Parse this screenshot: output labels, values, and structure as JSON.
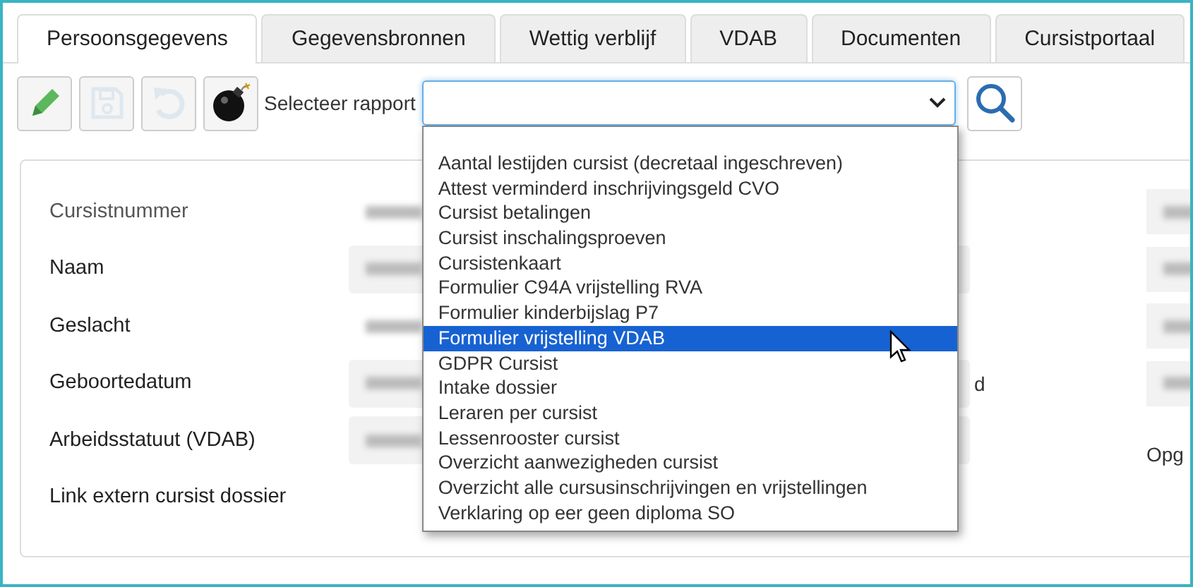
{
  "tabs": [
    {
      "label": "Persoonsgegevens",
      "selected": true
    },
    {
      "label": "Gegevensbronnen",
      "selected": false
    },
    {
      "label": "Wettig verblijf",
      "selected": false
    },
    {
      "label": "VDAB",
      "selected": false
    },
    {
      "label": "Documenten",
      "selected": false
    },
    {
      "label": "Cursistportaal",
      "selected": false
    }
  ],
  "toolbar": {
    "buttons": [
      {
        "kind": "edit",
        "disabled": false
      },
      {
        "kind": "save",
        "disabled": true
      },
      {
        "kind": "undo",
        "disabled": true
      },
      {
        "kind": "bomb",
        "disabled": false
      }
    ],
    "report_select": {
      "label": "Selecteer rapport",
      "expanded": true,
      "options": [
        {
          "label": "Aantal lestijden cursist (decretaal ingeschreven)",
          "selected": false
        },
        {
          "label": "Attest verminderd inschrijvingsgeld CVO",
          "selected": false
        },
        {
          "label": "Cursist betalingen",
          "selected": false
        },
        {
          "label": "Cursist inschalingsproeven",
          "selected": false
        },
        {
          "label": "Cursistenkaart",
          "selected": false
        },
        {
          "label": "Formulier C94A vrijstelling RVA",
          "selected": false
        },
        {
          "label": "Formulier kinderbijslag P7",
          "selected": false
        },
        {
          "label": "Formulier vrijstelling VDAB",
          "selected": true
        },
        {
          "label": "GDPR Cursist",
          "selected": false
        },
        {
          "label": "Intake dossier",
          "selected": false
        },
        {
          "label": "Leraren per cursist",
          "selected": false
        },
        {
          "label": "Lessenrooster cursist",
          "selected": false
        },
        {
          "label": "Overzicht aanwezigheden cursist",
          "selected": false
        },
        {
          "label": "Overzicht alle cursusinschrijvingen en vrijstellingen",
          "selected": false
        },
        {
          "label": "Verklaring op eer geen diploma SO",
          "selected": false
        }
      ]
    }
  },
  "form": {
    "rows": [
      {
        "label": "Cursistnummer",
        "bold": false,
        "value": {
          "kind": "redacted"
        },
        "right": {
          "kind": "box"
        }
      },
      {
        "label": "Naam",
        "bold": true,
        "value": {
          "kind": "box"
        },
        "right": {
          "kind": "box"
        }
      },
      {
        "label": "Geslacht",
        "bold": true,
        "value": {
          "kind": "redacted"
        },
        "right": {
          "kind": "box"
        }
      },
      {
        "label": "Geboortedatum",
        "bold": true,
        "value": {
          "kind": "box"
        },
        "side_label": "d",
        "right": {
          "kind": "box"
        }
      },
      {
        "label": "Arbeidsstatuut (VDAB)",
        "bold": true,
        "value": {
          "kind": "box"
        },
        "right": {
          "kind": "label",
          "text": "Opg"
        }
      },
      {
        "label": "Link extern cursist dossier",
        "bold": true
      }
    ]
  }
}
